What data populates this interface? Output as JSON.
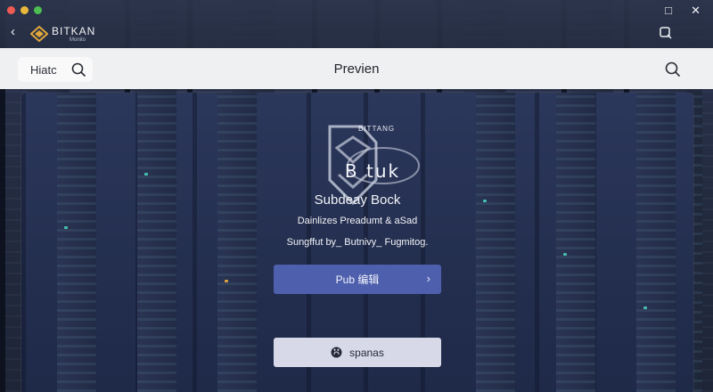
{
  "window": {
    "maximize_glyph": "□",
    "close_glyph": "✕"
  },
  "titlebar": {
    "back_glyph": "‹",
    "brand_name": "BITKAN",
    "brand_sub": "Monito",
    "icons": [
      "back-icon",
      "brand-logo-icon",
      "search-icon"
    ]
  },
  "header": {
    "search_label": "Hiatc",
    "title": "Previen"
  },
  "preview": {
    "logo_tag": "BITTANG",
    "logo_title": "B tuk",
    "subtitle": "Subdeay Bock",
    "line1": "Dainlizes Preadumt & aSad",
    "line2": "Sungffut by_ Butnivy_ Fugmitog.",
    "primary_button": "Pub 编辑",
    "primary_chevron": "›",
    "secondary_button": "spanas"
  },
  "colors": {
    "accent": "#4e5fae",
    "header_bg": "#eff0f2",
    "secondary_button_bg": "#d7d9e8"
  }
}
